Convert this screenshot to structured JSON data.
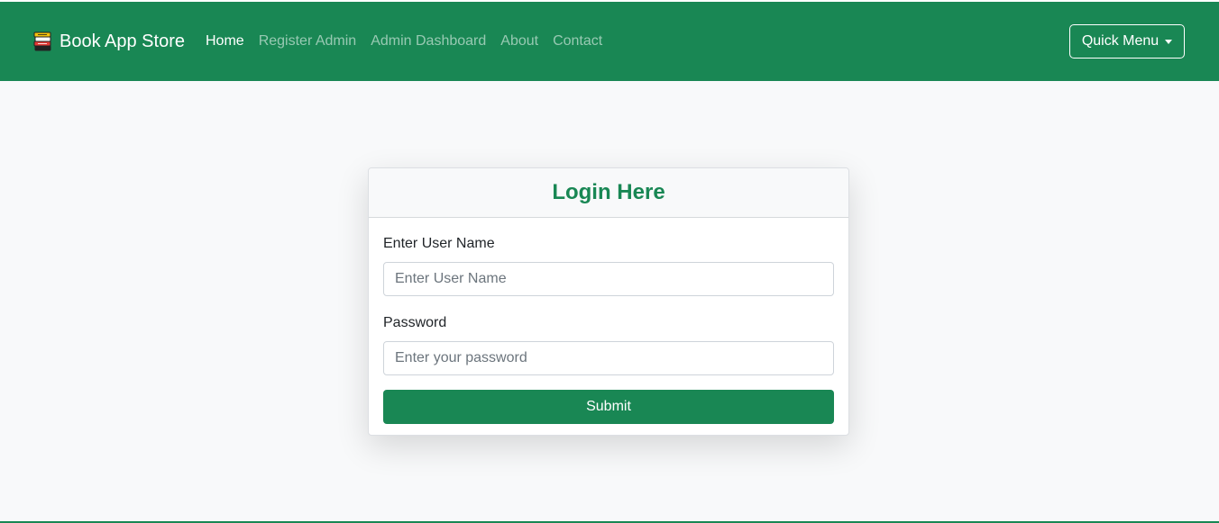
{
  "navbar": {
    "brand": {
      "label": "Book App Store",
      "icon": "books-icon"
    },
    "links": [
      {
        "label": "Home",
        "active": true
      },
      {
        "label": "Register Admin",
        "active": false
      },
      {
        "label": "Admin Dashboard",
        "active": false
      },
      {
        "label": "About",
        "active": false
      },
      {
        "label": "Contact",
        "active": false
      }
    ],
    "quick_menu": {
      "label": "Quick Menu",
      "icon": "caret-down-icon"
    }
  },
  "login": {
    "title": "Login Here",
    "username": {
      "label": "Enter User Name",
      "placeholder": "Enter User Name",
      "value": ""
    },
    "password": {
      "label": "Password",
      "placeholder": "Enter your password",
      "value": ""
    },
    "submit_label": "Submit"
  },
  "colors": {
    "primary": "#198754",
    "page_background": "#f8f9fa",
    "nav_muted_text": "rgba(255,255,255,0.55)"
  }
}
